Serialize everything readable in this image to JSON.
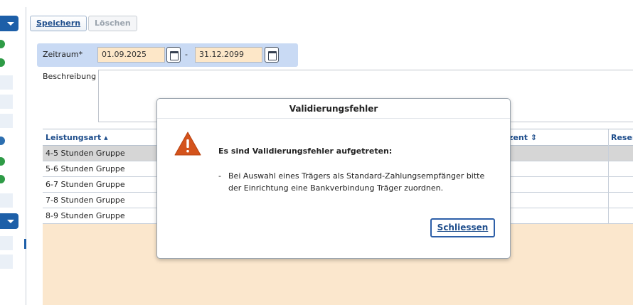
{
  "toolbar": {
    "save_label": "Speichern",
    "delete_label": "Löschen"
  },
  "period": {
    "label": "Zeitraum*",
    "from": "01.09.2025",
    "separator": "-",
    "to": "31.12.2099"
  },
  "description": {
    "label": "Beschreibung",
    "value": ""
  },
  "table": {
    "columns": [
      {
        "label": "Leistungsart",
        "sort": "▴"
      },
      {
        "label": "zent",
        "sort": "⇕"
      },
      {
        "label": "Reser"
      }
    ],
    "rows": [
      "4-5 Stunden Gruppe",
      "5-6 Stunden Gruppe",
      "6-7 Stunden Gruppe",
      "7-8 Stunden Gruppe",
      "8-9 Stunden Gruppe"
    ]
  },
  "dialog": {
    "title": "Validierungsfehler",
    "heading": "Es sind Validierungsfehler aufgetreten:",
    "bullet": "-",
    "message": "Bei Auswahl eines Trägers als Standard-Zahlungsempfänger bitte der Einrichtung eine Bankverbindung Träger zuordnen.",
    "close_label": "Schliessen"
  },
  "colors": {
    "accent": "#1f4e8c",
    "period_bg": "#c9daf4",
    "date_bg": "#fde7c8",
    "table_fill": "#fbe7cd",
    "warning": "#d4531c"
  },
  "icons": [
    "chevron-down-icon",
    "status-dot-icon",
    "calendar-icon",
    "warning-icon"
  ]
}
